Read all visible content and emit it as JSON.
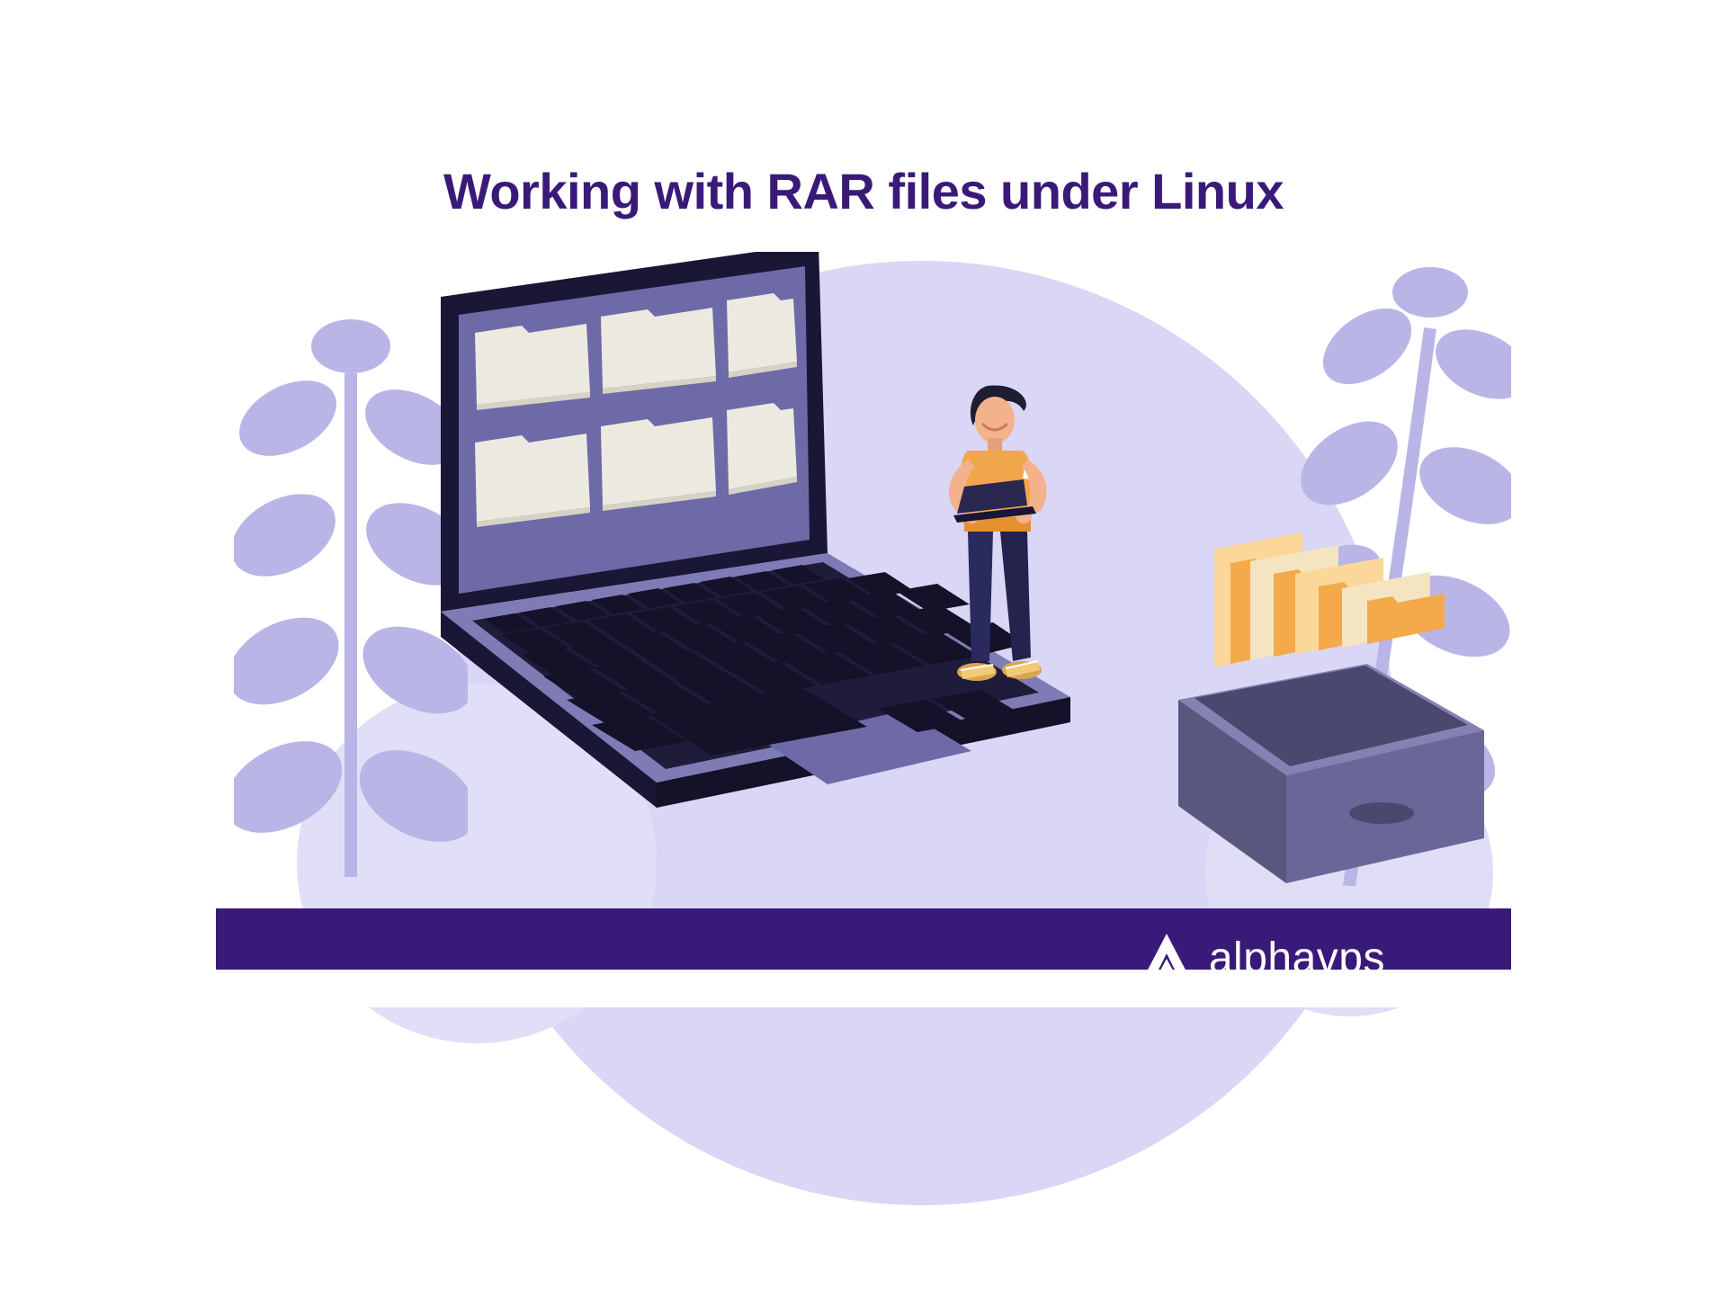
{
  "headline": "Working with RAR files under Linux",
  "brand": {
    "name": "alphavps"
  },
  "colors": {
    "purple_dark": "#3a1a78",
    "purple_light": "#d9d6f6",
    "leaf": "#b9b5e6",
    "laptop_frame": "#1a1636",
    "laptop_body": "#7e7bb5",
    "laptop_screen": "#6e6aa8",
    "key_dark": "#141128",
    "folder_light": "#eceae0",
    "folder_shadow": "#d6d2c4",
    "person_shirt": "#f2a64b",
    "person_pants": "#2a2a5f",
    "person_skin": "#f3b28b",
    "person_hair": "#1e1e32",
    "drawer_body": "#6a6798",
    "drawer_front": "#5a577f",
    "file_orange": "#f4a94a",
    "file_orange_light": "#fcd79a",
    "file_cream": "#f4e4c1"
  }
}
